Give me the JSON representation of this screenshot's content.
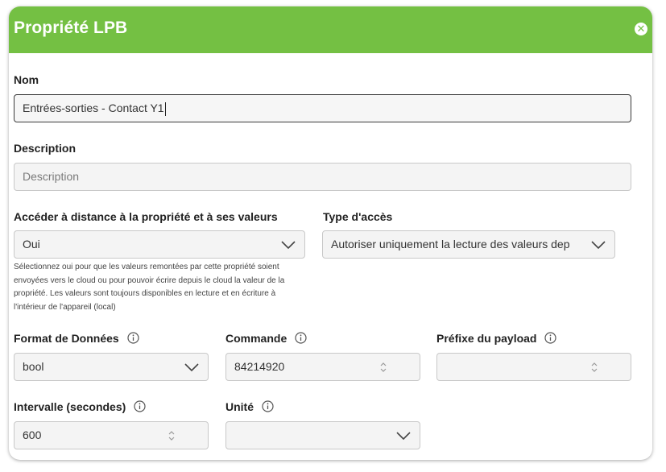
{
  "dialog": {
    "title": "Propriété LPB",
    "close_icon": "close-icon"
  },
  "fields": {
    "name": {
      "label": "Nom",
      "value": "Entrées-sorties - Contact Y1"
    },
    "description": {
      "label": "Description",
      "placeholder": "Description"
    },
    "remote_access": {
      "label": "Accéder à distance à la propriété et à ses valeurs",
      "value": "Oui",
      "help": "Sélectionnez oui pour que les valeurs remontées par cette propriété soient envoyées vers le cloud ou pour pouvoir écrire depuis le cloud la valeur de la propriété. Les valeurs sont toujours disponibles en lecture et en écriture à l'intérieur de l'appareil (local)"
    },
    "access_type": {
      "label": "Type d'accès",
      "value": "Autoriser uniquement la lecture des valeurs dep"
    },
    "data_format": {
      "label": "Format de Données",
      "value": "bool"
    },
    "command": {
      "label": "Commande",
      "value": "84214920"
    },
    "payload_prefix": {
      "label": "Préfixe du payload",
      "value": ""
    },
    "interval": {
      "label": "Intervalle (secondes)",
      "value": "600"
    },
    "unit": {
      "label": "Unité",
      "value": ""
    }
  },
  "colors": {
    "header": "#74c043",
    "header_text": "#ffffff"
  }
}
